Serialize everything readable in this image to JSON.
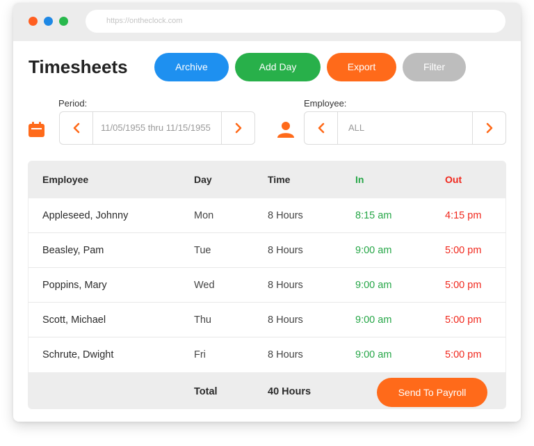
{
  "browser": {
    "url": "https://ontheclock.com"
  },
  "page": {
    "title": "Timesheets"
  },
  "toolbar": {
    "archive_label": "Archive",
    "add_day_label": "Add Day",
    "export_label": "Export",
    "filter_label": "Filter"
  },
  "filters": {
    "period_label": "Period:",
    "period_value": "11/05/1955 thru 11/15/1955",
    "employee_label": "Employee:",
    "employee_value": "ALL"
  },
  "table": {
    "headers": [
      "Employee",
      "Day",
      "Time",
      "In",
      "Out"
    ],
    "rows": [
      [
        "Appleseed, Johnny",
        "Mon",
        "8 Hours",
        "8:15 am",
        "4:15 pm"
      ],
      [
        "Beasley, Pam",
        "Tue",
        "8 Hours",
        "9:00 am",
        "5:00 pm"
      ],
      [
        "Poppins, Mary",
        "Wed",
        "8 Hours",
        "9:00 am",
        "5:00 pm"
      ],
      [
        "Scott, Michael",
        "Thu",
        "8 Hours",
        "9:00 am",
        "5:00 pm"
      ],
      [
        "Schrute, Dwight",
        "Fri",
        "8 Hours",
        "9:00 am",
        "5:00 pm"
      ]
    ],
    "total_label": "Total",
    "total_value": "40 Hours",
    "send_label": "Send To Payroll"
  },
  "colors": {
    "accent_orange": "#ff6a1a",
    "archive_blue": "#1e90f0",
    "add_green": "#28b04a",
    "filter_gray": "#bdbdbd",
    "in_green": "#26a647",
    "out_red": "#f0271c"
  },
  "icons": {
    "period": "calendar-icon",
    "employee": "person-icon",
    "prev": "chevron-left-icon",
    "next": "chevron-right-icon"
  }
}
